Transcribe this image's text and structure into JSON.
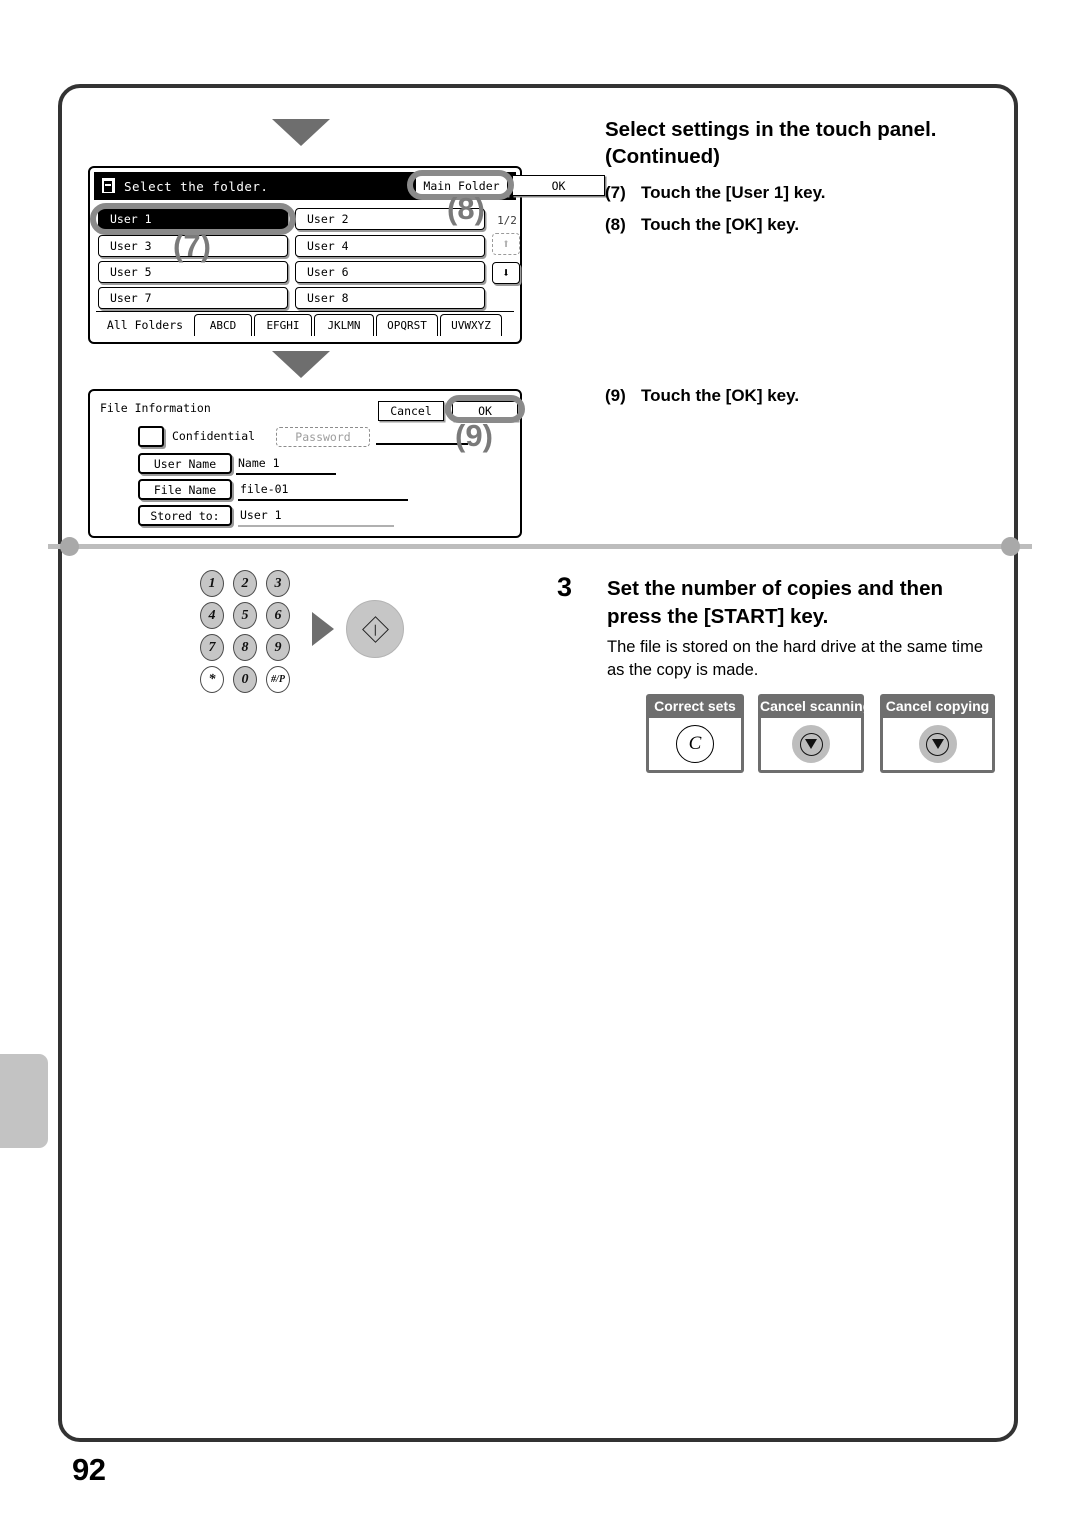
{
  "page": {
    "number": "92"
  },
  "right_column": {
    "heading_line1": "Select settings in the touch panel.",
    "heading_line2": "(Continued)",
    "steps": [
      {
        "num": "(7)",
        "text": "Touch the [User 1] key."
      },
      {
        "num": "(8)",
        "text": "Touch the [OK] key."
      },
      {
        "num": "(9)",
        "text": "Touch the [OK] key."
      }
    ]
  },
  "callouts": {
    "seven": "(7)",
    "eight": "(8)",
    "nine": "(9)"
  },
  "folder_panel": {
    "icon": "document-folder-icon",
    "title": "Select the folder.",
    "main_folder_label": "Main Folder",
    "ok_label": "OK",
    "page_indicator": "1/2",
    "scroll_up_icon": "arrow-up-icon",
    "scroll_down_icon": "arrow-down-icon",
    "user_keys": [
      {
        "label": "User 1",
        "selected": true
      },
      {
        "label": "User 2",
        "selected": false
      },
      {
        "label": "User 3",
        "selected": false
      },
      {
        "label": "User 4",
        "selected": false
      },
      {
        "label": "User 5",
        "selected": false
      },
      {
        "label": "User 6",
        "selected": false
      },
      {
        "label": "User 7",
        "selected": false
      },
      {
        "label": "User 8",
        "selected": false
      }
    ],
    "tabs": [
      {
        "label": "All Folders",
        "active": true
      },
      {
        "label": "ABCD",
        "active": false
      },
      {
        "label": "EFGHI",
        "active": false
      },
      {
        "label": "JKLMN",
        "active": false
      },
      {
        "label": "OPQRST",
        "active": false
      },
      {
        "label": "UVWXYZ",
        "active": false
      }
    ]
  },
  "file_info_panel": {
    "title": "File Information",
    "cancel_label": "Cancel",
    "ok_label": "OK",
    "confidential_label": "Confidential",
    "password_label": "Password",
    "rows": [
      {
        "key": "User Name",
        "value": "Name 1"
      },
      {
        "key": "File Name",
        "value": "file-01"
      },
      {
        "key": "Stored to:",
        "value": "User 1"
      }
    ]
  },
  "step3": {
    "number": "3",
    "title_line1": "Set the number of copies and then",
    "title_line2": "press the [START] key.",
    "body": "The file is stored on the hard drive at the same time as the copy is made.",
    "key_cards": [
      {
        "label": "Correct sets",
        "glyph": "C",
        "style": "white"
      },
      {
        "label": "Cancel scanning",
        "glyph": "stop",
        "style": "gray"
      },
      {
        "label": "Cancel copying",
        "glyph": "stop",
        "style": "gray"
      }
    ]
  },
  "keypad": {
    "rows": [
      [
        "1",
        "2",
        "3"
      ],
      [
        "4",
        "5",
        "6"
      ],
      [
        "7",
        "8",
        "9"
      ],
      [
        "*",
        "0",
        "#/P"
      ]
    ],
    "start_key_icon": "start-key-icon"
  }
}
